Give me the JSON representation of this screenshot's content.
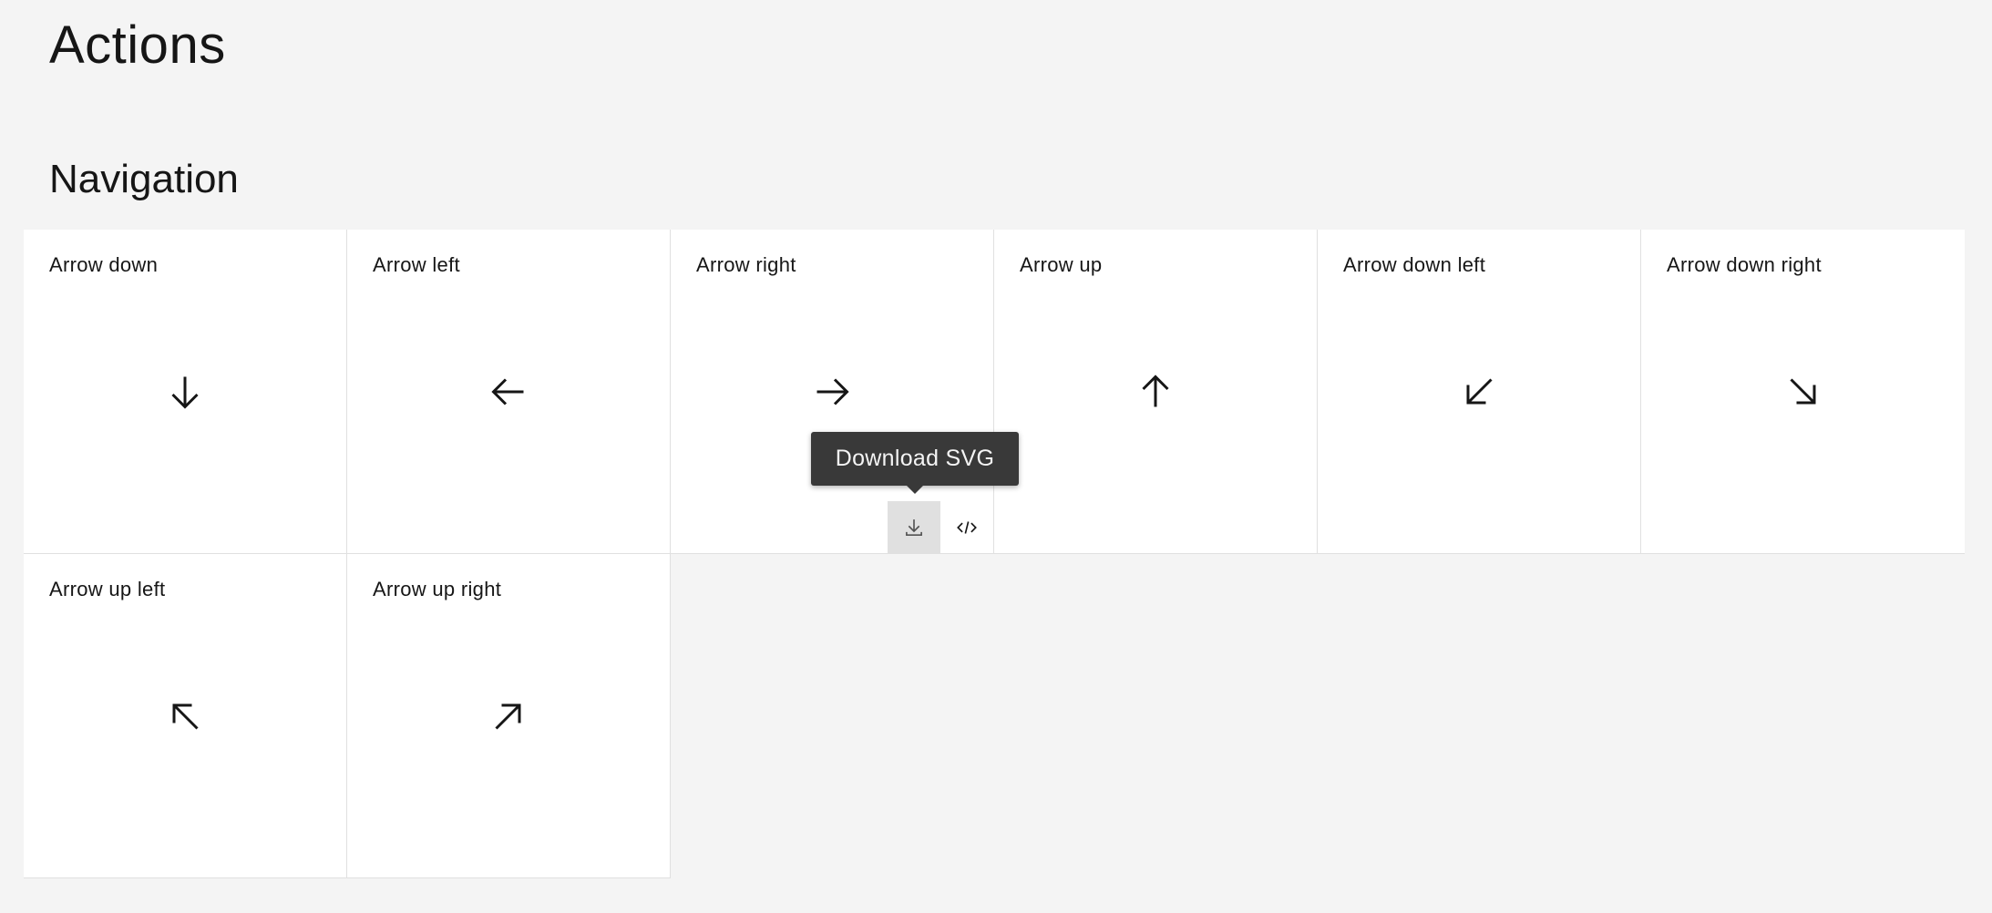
{
  "page": {
    "title": "Actions",
    "section_title": "Navigation"
  },
  "colors": {
    "background": "#f4f4f4",
    "tile": "#ffffff",
    "text": "#161616",
    "tooltip_bg": "#393939",
    "tooltip_text": "#f4f4f4",
    "active_action": "#e0e0e0"
  },
  "tiles": [
    {
      "label": "Arrow down",
      "icon": "arrow-down-icon"
    },
    {
      "label": "Arrow left",
      "icon": "arrow-left-icon"
    },
    {
      "label": "Arrow right",
      "icon": "arrow-right-icon",
      "hovered": true
    },
    {
      "label": "Arrow up",
      "icon": "arrow-up-icon"
    },
    {
      "label": "Arrow down left",
      "icon": "arrow-down-left-icon"
    },
    {
      "label": "Arrow down right",
      "icon": "arrow-down-right-icon"
    },
    {
      "label": "Arrow up left",
      "icon": "arrow-up-left-icon"
    },
    {
      "label": "Arrow up right",
      "icon": "arrow-up-right-icon"
    }
  ],
  "tile_actions": {
    "download_icon": "download-icon",
    "code_icon": "code-icon"
  },
  "tooltip": {
    "text": "Download SVG"
  }
}
